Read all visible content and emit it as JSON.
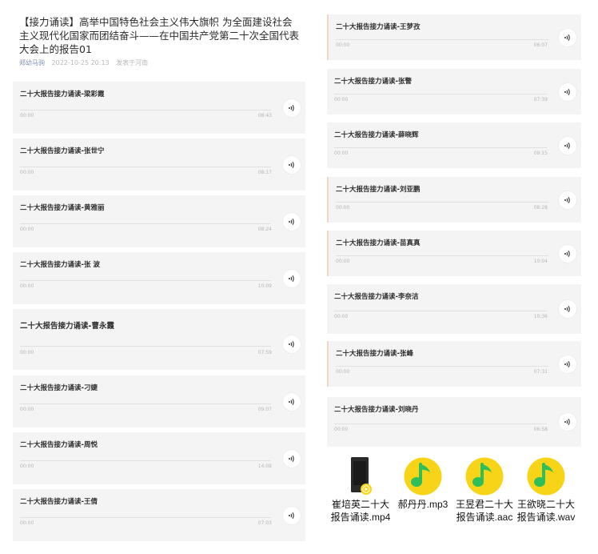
{
  "article": {
    "title": "【接力诵读】高举中国特色社会主义伟大旗帜 为全面建设社会主义现代化国家而团结奋斗——在中国共产党第二十次全国代表大会上的报告01",
    "author": "郑幼马驹",
    "date": "2022-10-25 20:13",
    "location": "发表于河南"
  },
  "left_audio": [
    {
      "title": "二十大报告接力诵读-梁彩霞",
      "current": "00:00",
      "duration": "08:43"
    },
    {
      "title": "二十大报告接力诵读-张世宁",
      "current": "00:00",
      "duration": "08:17"
    },
    {
      "title": "二十大报告接力诵读-黄雅丽",
      "current": "00:00",
      "duration": "08:24"
    },
    {
      "title": "二十大报告接力诵读-张 波",
      "current": "00:00",
      "duration": "10:09"
    },
    {
      "title": "二十大报告接力诵读-曹永霞",
      "current": "00:00",
      "duration": "07:59"
    },
    {
      "title": "二十大报告接力诵读-刁婕",
      "current": "00:00",
      "duration": "09:07"
    },
    {
      "title": "二十大报告接力诵读-周悦",
      "current": "00:00",
      "duration": "14:08"
    },
    {
      "title": "二十大报告接力诵读-王倩",
      "current": "00:00",
      "duration": "07:03"
    }
  ],
  "right_audio": [
    {
      "title": "二十大报告接力诵读-王梦孜",
      "current": "00:00",
      "duration": "06:07"
    },
    {
      "title": "二十大报告接力诵读-张警",
      "current": "00:00",
      "duration": "07:39"
    },
    {
      "title": "二十大报告接力诵读-薛晓辉",
      "current": "00:00",
      "duration": "09:15"
    },
    {
      "title": "二十大报告接力诵读-刘亚鹏",
      "current": "00:00",
      "duration": "08:28"
    },
    {
      "title": "二十大报告接力诵读-苗真真",
      "current": "00:00",
      "duration": "10:04"
    },
    {
      "title": "二十大报告接力诵读-李奈洁",
      "current": "00:00",
      "duration": "10:36"
    },
    {
      "title": "二十大报告接力诵读-张峰",
      "current": "00:00",
      "duration": "07:31"
    },
    {
      "title": "二十大报告接力诵读-刘晓丹",
      "current": "00:00",
      "duration": "06:58"
    }
  ],
  "files": [
    {
      "name": "崔培英二十大报告诵读.mp4",
      "icon": "video-file-icon"
    },
    {
      "name": "郝丹丹.mp3",
      "icon": "music-file-icon"
    },
    {
      "name": "王昱君二十大报告诵读.aac",
      "icon": "music-file-icon"
    },
    {
      "name": "王欲晓二十大报告诵读.wav",
      "icon": "music-file-icon"
    }
  ],
  "colors": {
    "card_background": "#f4f4f4",
    "music_icon_yellow": "#f7d417",
    "music_icon_green": "#2fbf5a",
    "video_badge": "#f7d417"
  }
}
